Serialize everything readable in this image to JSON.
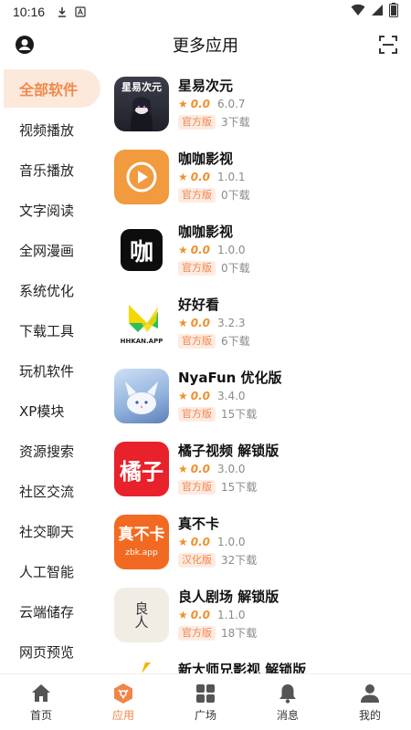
{
  "status_bar": {
    "time": "10:16"
  },
  "header": {
    "title": "更多应用"
  },
  "sidebar": {
    "items": [
      {
        "label": "全部软件"
      },
      {
        "label": "视频播放"
      },
      {
        "label": "音乐播放"
      },
      {
        "label": "文字阅读"
      },
      {
        "label": "全网漫画"
      },
      {
        "label": "系统优化"
      },
      {
        "label": "下载工具"
      },
      {
        "label": "玩机软件"
      },
      {
        "label": "XP模块"
      },
      {
        "label": "资源搜索"
      },
      {
        "label": "社区交流"
      },
      {
        "label": "社交聊天"
      },
      {
        "label": "人工智能"
      },
      {
        "label": "云端储存"
      },
      {
        "label": "网页预览"
      }
    ]
  },
  "apps": [
    {
      "name": "星易次元",
      "rating": "0.0",
      "version": "6.0.7",
      "tag": "官方版",
      "downloads": "3下载",
      "icon_text": "星易次元"
    },
    {
      "name": "咖咖影视",
      "rating": "0.0",
      "version": "1.0.1",
      "tag": "官方版",
      "downloads": "0下载"
    },
    {
      "name": "咖咖影视",
      "rating": "0.0",
      "version": "1.0.0",
      "tag": "官方版",
      "downloads": "0下载",
      "icon_text": "咖"
    },
    {
      "name": "好好看",
      "rating": "0.0",
      "version": "3.2.3",
      "tag": "官方版",
      "downloads": "6下载",
      "icon_text": "HHKAN.APP"
    },
    {
      "name": "NyaFun 优化版",
      "rating": "0.0",
      "version": "3.4.0",
      "tag": "官方版",
      "downloads": "15下载"
    },
    {
      "name": "橘子视频 解锁版",
      "rating": "0.0",
      "version": "3.0.0",
      "tag": "官方版",
      "downloads": "15下载",
      "icon_text": "橘子"
    },
    {
      "name": "真不卡",
      "rating": "0.0",
      "version": "1.0.0",
      "tag": "汉化版",
      "downloads": "32下载",
      "icon_text": "真不卡",
      "icon_subtext": "zbk.app"
    },
    {
      "name": "良人剧场 解锁版",
      "rating": "0.0",
      "version": "1.1.0",
      "tag": "官方版",
      "downloads": "18下载",
      "icon_text": "良人"
    },
    {
      "name": "新大师兄影视 解锁版",
      "rating": "",
      "version": "",
      "tag": "",
      "downloads": ""
    }
  ],
  "bottom_nav": [
    {
      "label": "首页",
      "icon": "home-icon"
    },
    {
      "label": "应用",
      "icon": "apps-icon"
    },
    {
      "label": "广场",
      "icon": "grid-icon"
    },
    {
      "label": "消息",
      "icon": "bell-icon"
    },
    {
      "label": "我的",
      "icon": "person-icon"
    }
  ],
  "colors": {
    "accent": "#f0854a",
    "active_bg": "#fde8dc",
    "rating": "#f0902b"
  }
}
